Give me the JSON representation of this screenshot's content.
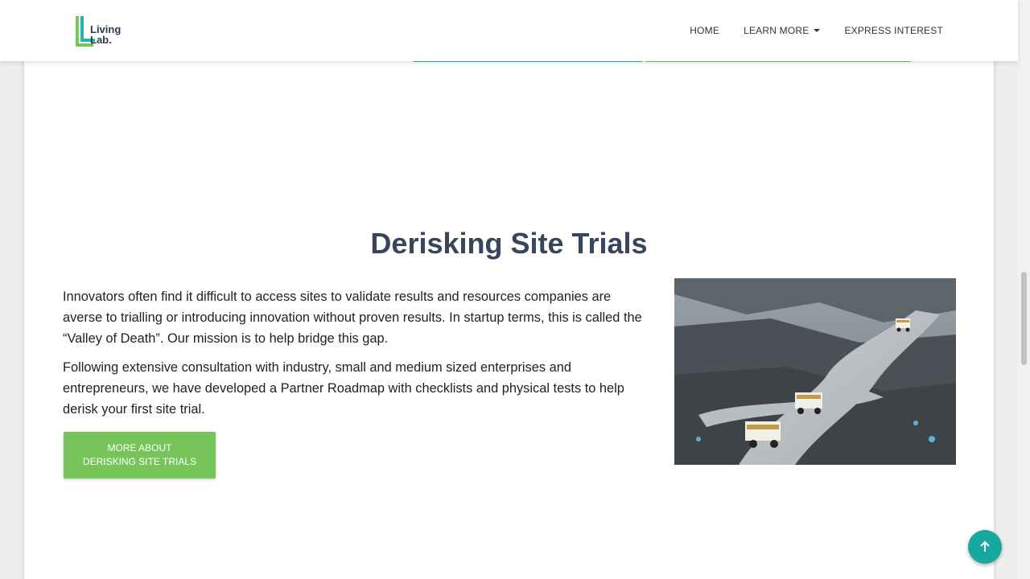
{
  "brand": {
    "logo_line1": "Living",
    "logo_line2": "Lab.",
    "accent_teal": "#1fb6b0",
    "accent_green": "#76c45a"
  },
  "nav": {
    "home": "HOME",
    "learn_more": "LEARN MORE",
    "express_interest": "EXPRESS INTEREST"
  },
  "section": {
    "title": "Derisking Site Trials",
    "paragraph1": "Innovators often find it difficult to access sites to validate results and resources companies are averse to trialling or introducing innovation without proven results. In startup terms, this is called the “Valley of Death”. Our mission is to help bridge this gap.",
    "paragraph2": "Following extensive consultation with industry, small and medium sized enterprises and entrepreneurs, we have developed a Partner Roadmap with checklists and physical tests to help derisk your first site trial.",
    "cta_line1": "MORE ABOUT",
    "cta_line2": "DERISKING SITE TRIALS",
    "photo_icon": "mining-haul-trucks-photo"
  },
  "back_to_top_icon": "arrow-up-icon"
}
